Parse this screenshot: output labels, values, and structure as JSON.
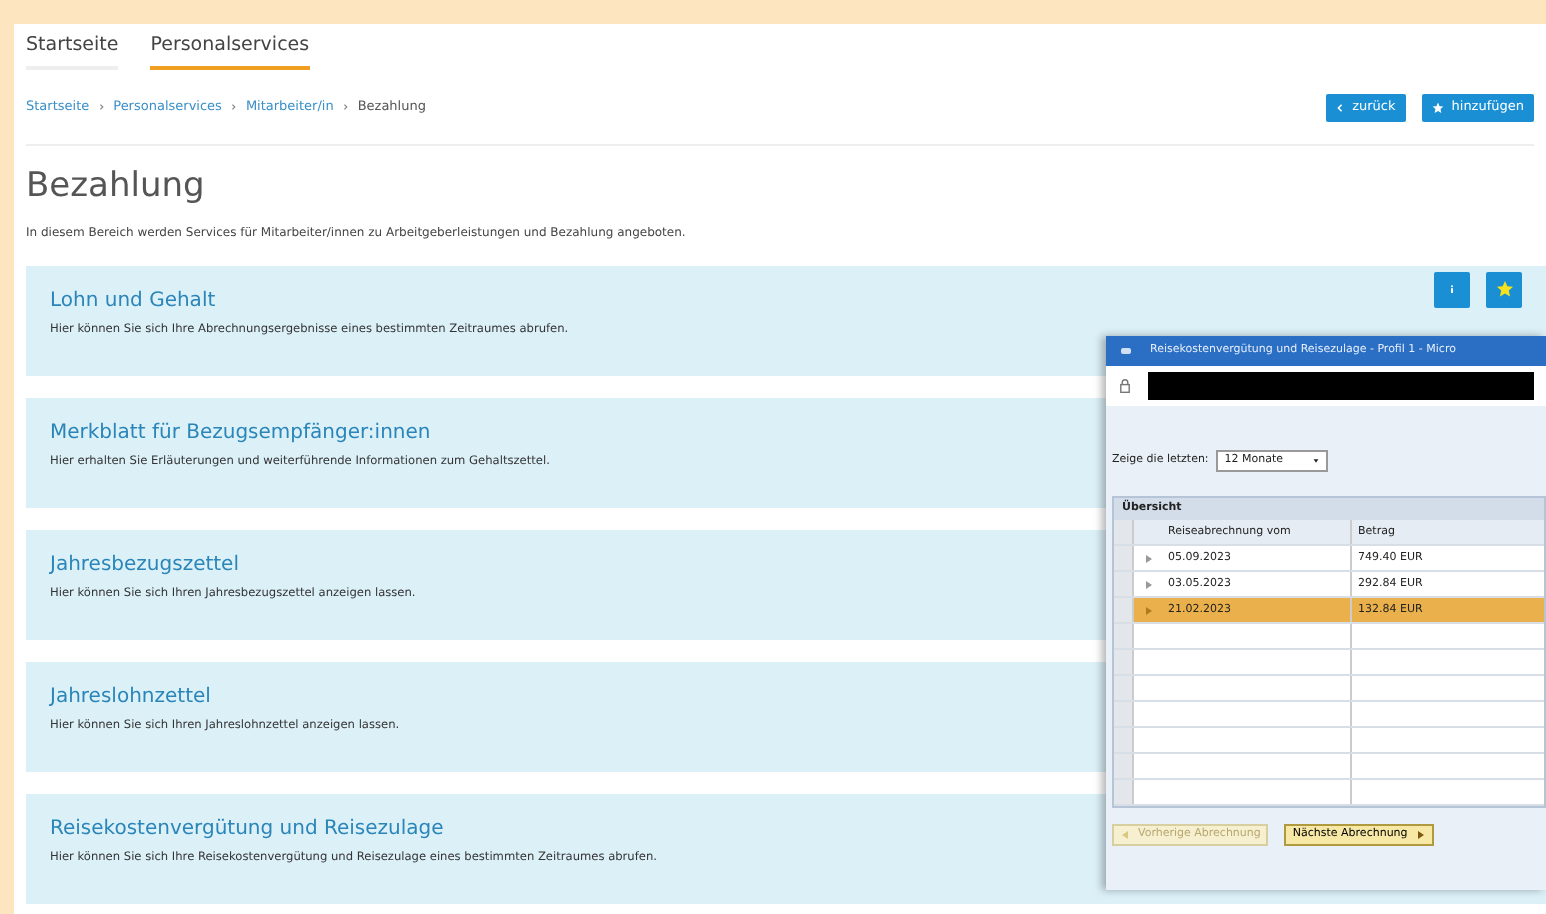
{
  "nav": [
    {
      "label": "Startseite",
      "selected": false
    },
    {
      "label": "Personalservices",
      "selected": true
    }
  ],
  "breadcrumb": [
    "Startseite",
    "Personalservices",
    "Mitarbeiter/in",
    "Bezahlung"
  ],
  "actions": [
    {
      "label": "zurück",
      "kind": "back"
    },
    {
      "label": "hinzufügen",
      "kind": "add"
    }
  ],
  "title": "Bezahlung",
  "intro": "In diesem Bereich werden Services für Mitarbeiter/innen zu Arbeitgeberleistungen und Bezahlung angeboten.",
  "services": [
    {
      "title": "Lohn und Gehalt",
      "description": "Hier können Sie sich Ihre Abrechnungsergebnisse eines bestimmten Zeitraumes abrufen.",
      "tools": true
    },
    {
      "title": "Merkblatt für Bezugsempfänger:innen",
      "description": "Hier erhalten Sie Erläuterungen und weiterführende Informationen zum Gehaltszettel."
    },
    {
      "title": "Jahresbezugszettel",
      "description": "Hier können Sie sich Ihren Jahresbezugszettel anzeigen lassen."
    },
    {
      "title": "Jahreslohnzettel",
      "description": "Hier können Sie sich Ihren Jahreslohnzettel anzeigen lassen."
    },
    {
      "title": "Reisekostenvergütung und Reisezulage",
      "description": "Hier können Sie sich Ihre Reisekostenvergütung und Reisezulage eines bestimmten Zeitraumes abrufen."
    }
  ],
  "overlay_window": {
    "title": "Reisekostenvergütung und Reisezulage - Profil 1 - Micro",
    "filter_label": "Zeige die letzten:",
    "filter_value": "12 Monate",
    "section": "Übersicht",
    "columns": [
      "Reiseabrechnung vom",
      "Betrag"
    ],
    "rows": [
      {
        "date": "05.09.2023",
        "amount": "749.40 EUR",
        "selected": false
      },
      {
        "date": "03.05.2023",
        "amount": "292.84 EUR",
        "selected": false
      },
      {
        "date": "21.02.2023",
        "amount": "132.84 EUR",
        "selected": true
      }
    ],
    "buttons": [
      {
        "label": "Vorherige Abrechnung",
        "kind": "prev",
        "disabled": true
      },
      {
        "label": "Nächste Abrechnung",
        "kind": "next",
        "disabled": false
      }
    ]
  }
}
